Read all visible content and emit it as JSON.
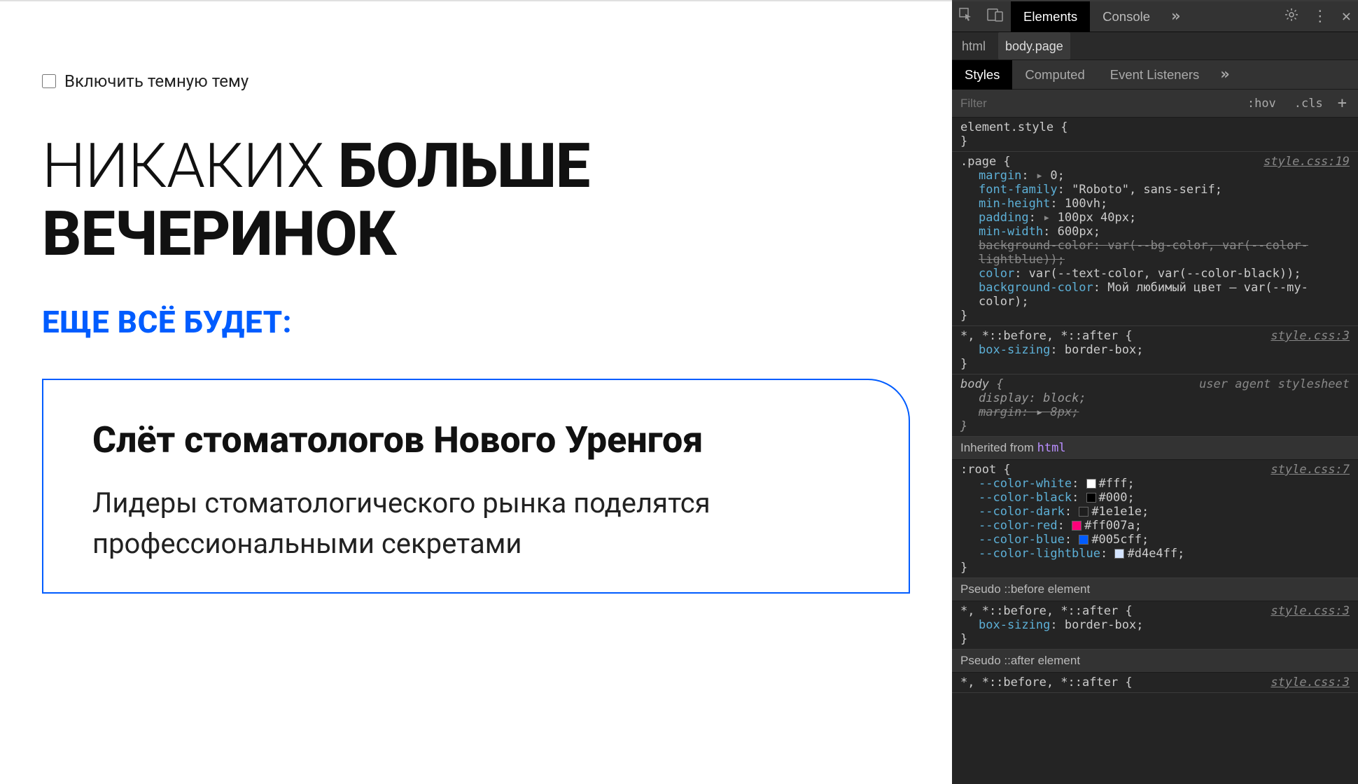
{
  "page": {
    "checkbox_label": "Включить темную тему",
    "headline_thin": "НИКАКИХ ",
    "headline_bold1": "БОЛЬШЕ ВЕЧЕРИНОК",
    "subhead": "ЕЩЕ ВСЁ БУДЕТ:",
    "card_title": "Слёт стоматологов Нового Уренгоя",
    "card_body": "Лидеры стоматологического рынка поделятся профессиональными секретами"
  },
  "devtools": {
    "tabs": {
      "elements": "Elements",
      "console": "Console"
    },
    "breadcrumb": {
      "html": "html",
      "body": "body.page"
    },
    "subtabs": {
      "styles": "Styles",
      "computed": "Computed",
      "listeners": "Event Listeners"
    },
    "filter": {
      "placeholder": "Filter",
      "hov": ":hov",
      "cls": ".cls"
    },
    "rules": {
      "element_style": {
        "selector": "element.style",
        "open": " {",
        "close": "}"
      },
      "page": {
        "selector": ".page",
        "link": "style.css:19",
        "decls": [
          {
            "prop": "margin",
            "val": "0",
            "expand": true
          },
          {
            "prop": "font-family",
            "val": "\"Roboto\", sans-serif"
          },
          {
            "prop": "min-height",
            "val": "100vh"
          },
          {
            "prop": "padding",
            "val": "100px 40px",
            "expand": true
          },
          {
            "prop": "min-width",
            "val": "600px"
          },
          {
            "prop": "background-color",
            "val": "var(--bg-color, var(--color-lightblue))",
            "strike": true,
            "wrap": true
          },
          {
            "prop": "color",
            "val": "var(--text-color, var(--color-black))"
          },
          {
            "prop": "background-color",
            "val": "Мой любимый цвет — var(--my-color)",
            "wrap": true
          }
        ]
      },
      "star1": {
        "selector_dim": "*, *::before, ",
        "selector_em": "*::after",
        "link": "style.css:3",
        "decl": {
          "prop": "box-sizing",
          "val": "border-box"
        }
      },
      "body_ua": {
        "selector": "body",
        "ua_label": "user agent stylesheet",
        "decls": [
          {
            "prop": "display",
            "val": "block"
          },
          {
            "prop": "margin",
            "val": "8px",
            "strike": true,
            "expand": true
          }
        ]
      },
      "inherit_label": "Inherited from ",
      "inherit_html": "html",
      "root": {
        "selector": ":root",
        "link": "style.css:7",
        "vars": [
          {
            "name": "--color-white",
            "hex": "#fff",
            "swatch": "#ffffff"
          },
          {
            "name": "--color-black",
            "hex": "#000",
            "swatch": "#000000"
          },
          {
            "name": "--color-dark",
            "hex": "#1e1e1e",
            "swatch": "#1e1e1e"
          },
          {
            "name": "--color-red",
            "hex": "#ff007a",
            "swatch": "#ff007a"
          },
          {
            "name": "--color-blue",
            "hex": "#005cff",
            "swatch": "#005cff"
          },
          {
            "name": "--color-lightblue",
            "hex": "#d4e4ff",
            "swatch": "#d4e4ff"
          }
        ]
      },
      "pseudo_before_label": "Pseudo ::before element",
      "star2": {
        "selector_dim1": "*, ",
        "selector_em": "*::before",
        "selector_dim2": ", *::after",
        "link": "style.css:3",
        "decl": {
          "prop": "box-sizing",
          "val": "border-box"
        }
      },
      "pseudo_after_label": "Pseudo ::after element",
      "star3": {
        "selector_dim": "*, *::before, ",
        "selector_em": "*::after",
        "link": "style.css:3"
      }
    }
  }
}
